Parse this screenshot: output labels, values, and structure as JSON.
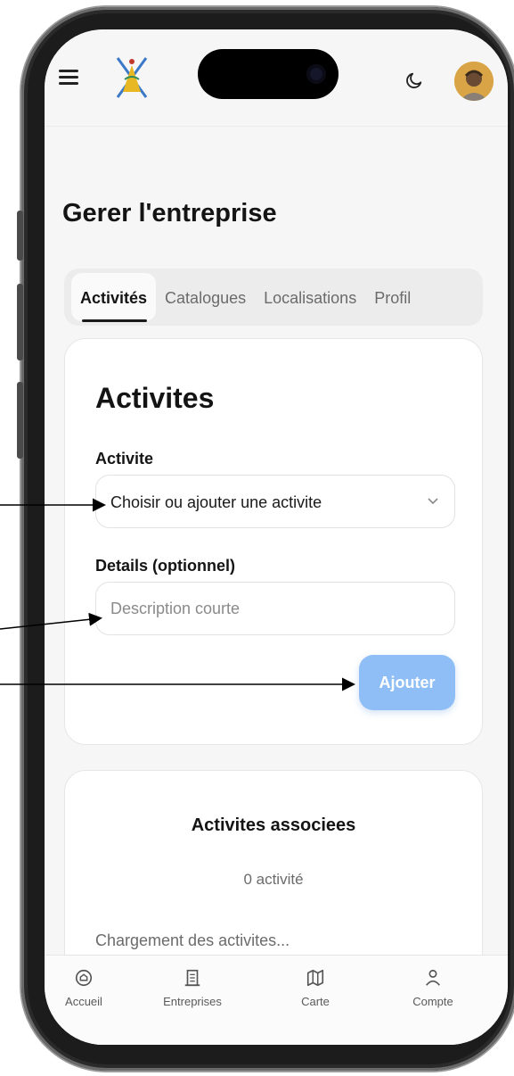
{
  "page": {
    "title": "Gerer l'entreprise"
  },
  "tabs": [
    {
      "label": "Activités",
      "active": true
    },
    {
      "label": "Catalogues",
      "active": false
    },
    {
      "label": "Localisations",
      "active": false
    },
    {
      "label": "Profil",
      "active": false
    }
  ],
  "activity_form": {
    "title": "Activites",
    "activity_label": "Activite",
    "activity_select_value": "Choisir ou ajouter une activite",
    "details_label": "Details (optionnel)",
    "details_placeholder": "Description courte",
    "details_value": "",
    "add_button": "Ajouter"
  },
  "associated": {
    "title": "Activites associees",
    "count": "0 activité",
    "loading": "Chargement des activites..."
  },
  "bottom_nav": [
    {
      "label": "Accueil",
      "icon": "home-icon"
    },
    {
      "label": "Entreprises",
      "icon": "building-icon"
    },
    {
      "label": "Carte",
      "icon": "map-icon"
    },
    {
      "label": "Compte",
      "icon": "user-icon"
    }
  ],
  "colors": {
    "accent_button": "#8fbef6",
    "background": "#f6f6f6",
    "card": "#ffffff",
    "text": "#141414"
  },
  "icons": {
    "menu": "menu-icon",
    "logo": "app-logo",
    "theme": "moon-icon",
    "avatar": "avatar",
    "select": "chevron-down-icon"
  }
}
